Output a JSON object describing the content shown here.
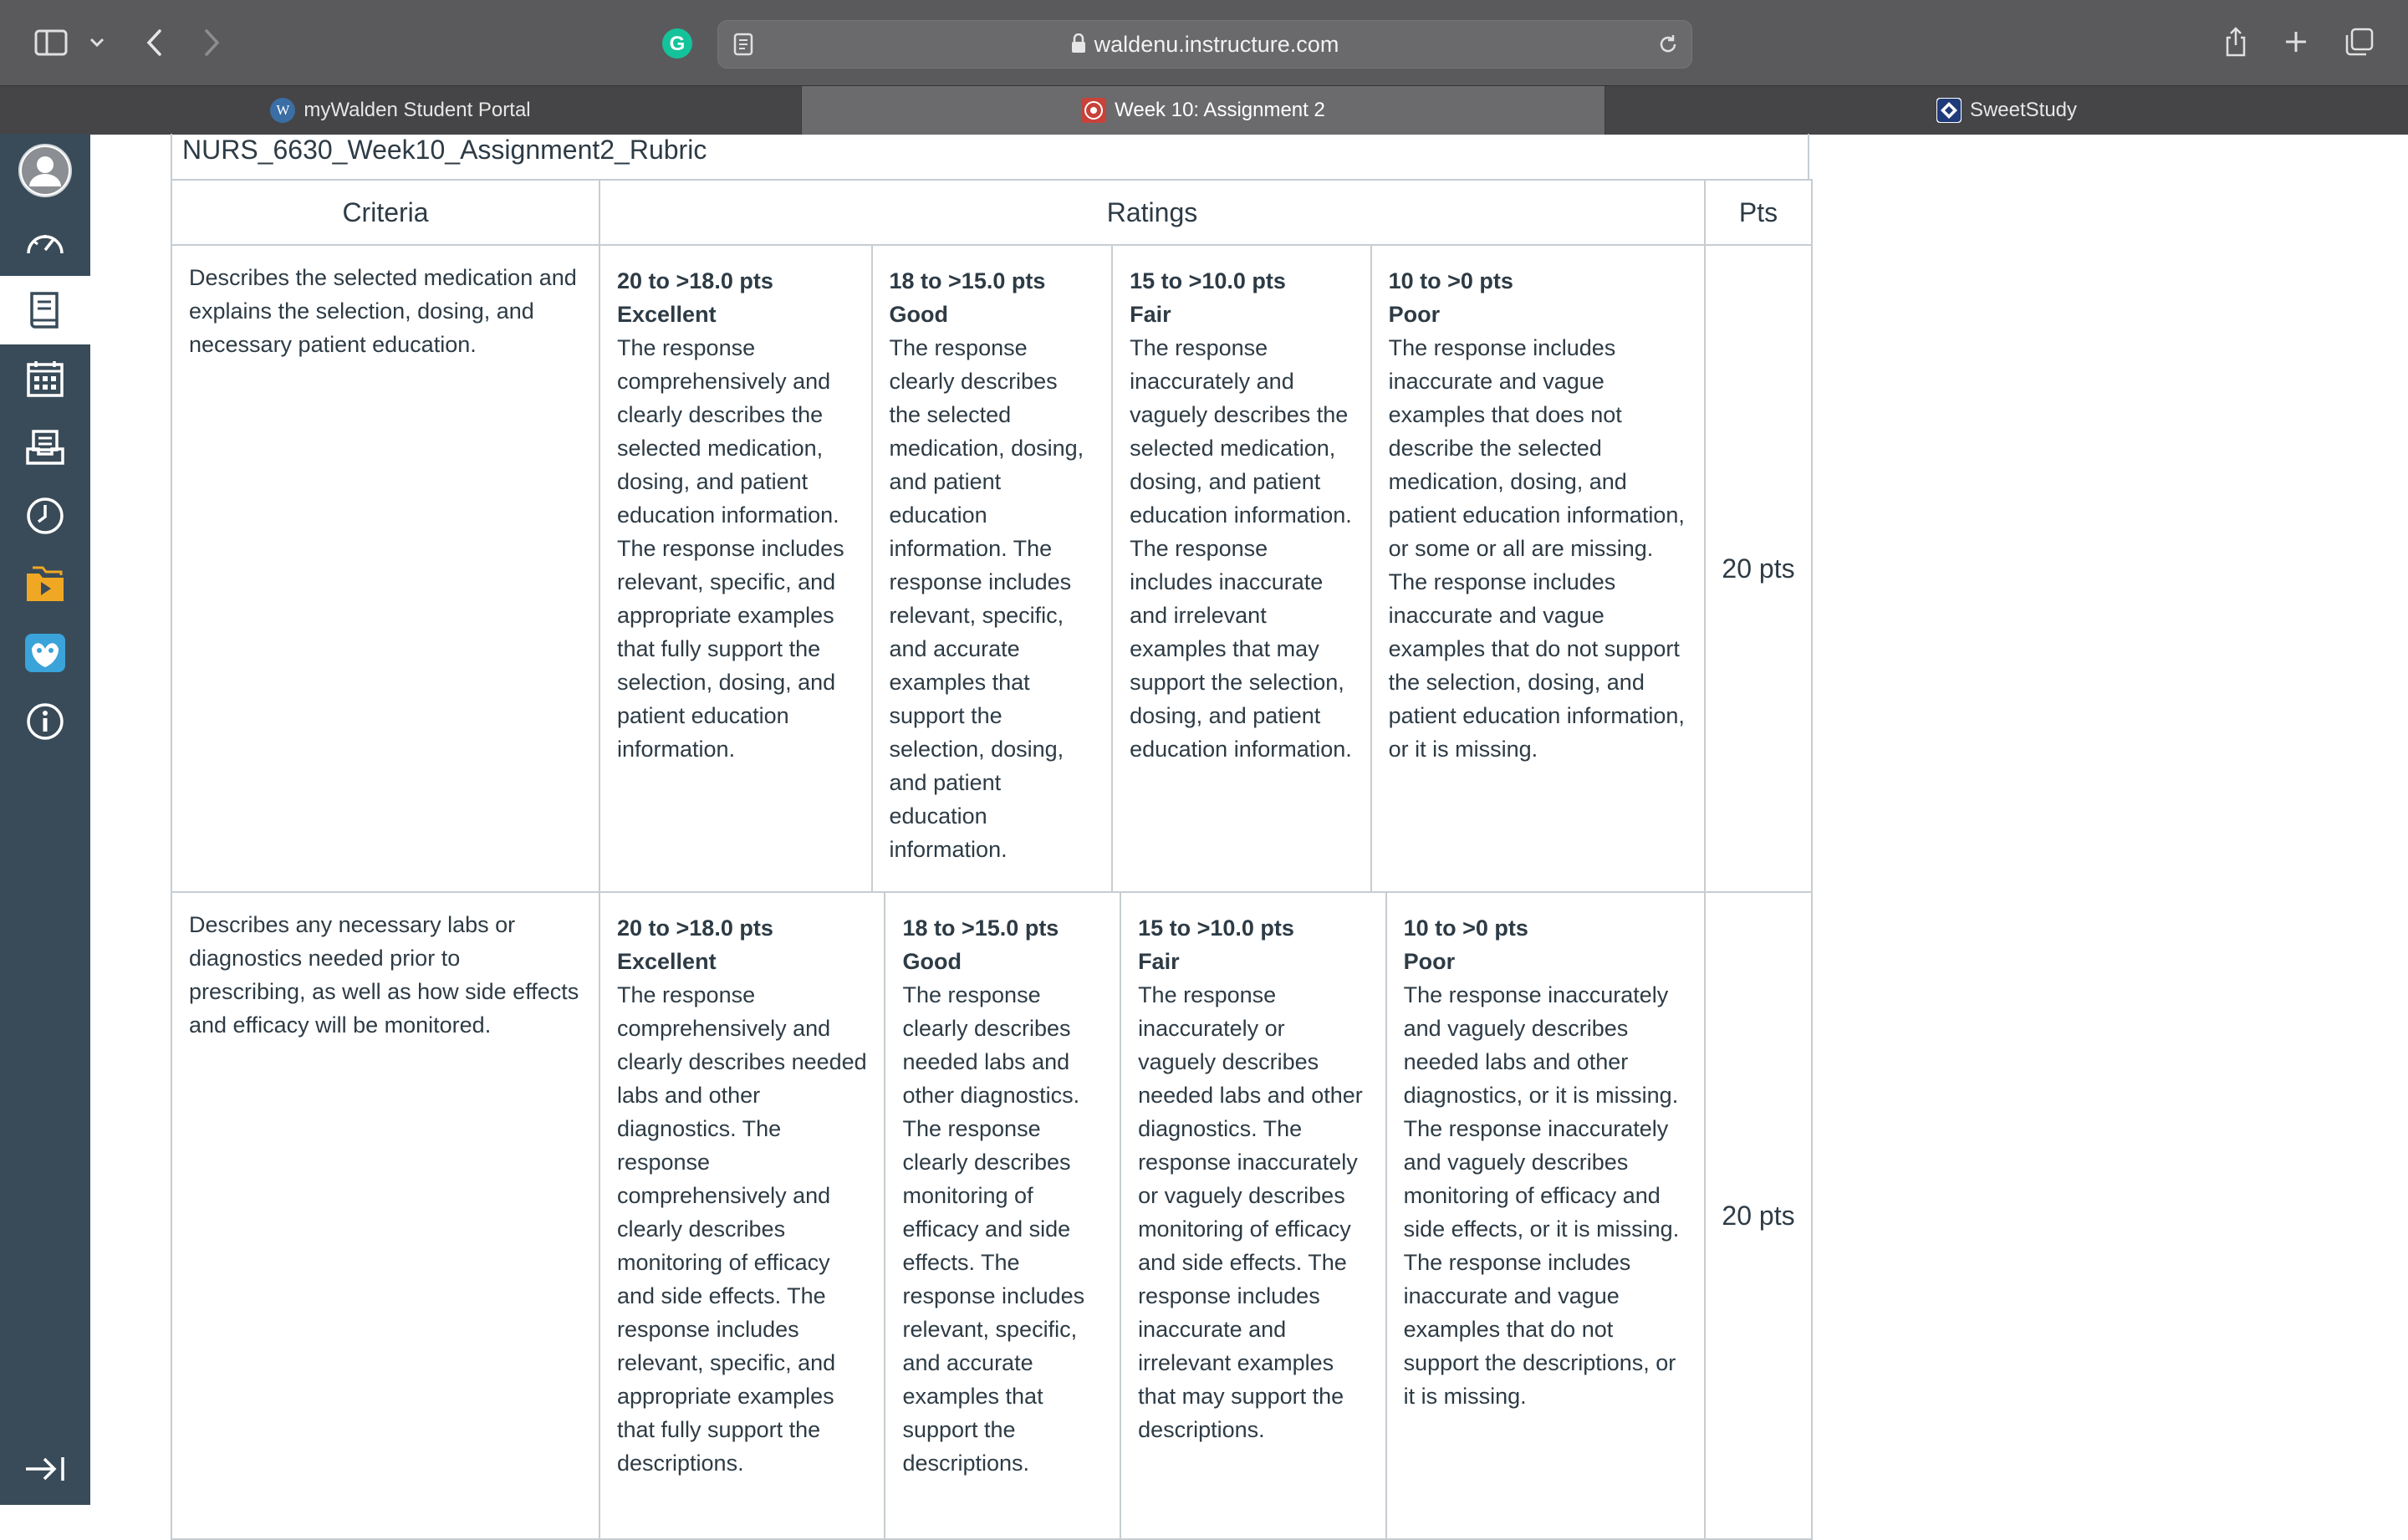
{
  "browser": {
    "url": "waldenu.instructure.com",
    "tabs": [
      {
        "label": "myWalden Student Portal",
        "favicon": "W"
      },
      {
        "label": "Week 10: Assignment 2",
        "favicon": ""
      },
      {
        "label": "SweetStudy",
        "favicon": ""
      }
    ]
  },
  "sidebar": {
    "items": [
      "account-icon",
      "dashboard-icon",
      "courses-icon",
      "calendar-icon",
      "inbox-icon",
      "history-icon",
      "files-icon",
      "help-icon",
      "info-icon"
    ],
    "collapse_icon": "collapse-nav-icon"
  },
  "rubric": {
    "title": "NURS_6630_Week10_Assignment2_Rubric",
    "headers": {
      "criteria": "Criteria",
      "ratings": "Ratings",
      "pts": "Pts"
    },
    "rows": [
      {
        "criteria": "Describes the selected medication and explains the selection, dosing, and necessary patient education.",
        "points": "20 pts",
        "ratings": [
          {
            "pts": "20 to >18.0 pts",
            "level": "Excellent",
            "desc": "The response comprehensively and clearly describes the selected medication, dosing, and patient education information. The response includes relevant, specific, and appropriate examples that fully support the selection, dosing, and patient education information."
          },
          {
            "pts": "18 to >15.0 pts",
            "level": "Good",
            "desc": "The response clearly describes the selected medication, dosing, and patient education information. The response includes relevant, specific, and accurate examples that support the selection, dosing, and patient education information."
          },
          {
            "pts": "15 to >10.0 pts",
            "level": "Fair",
            "desc": "The response inaccurately and vaguely describes the selected medication, dosing, and patient education information. The response includes inaccurate and irrelevant examples that may support the selection, dosing, and patient education information."
          },
          {
            "pts": "10 to >0 pts",
            "level": "Poor",
            "desc": "The response includes inaccurate and vague examples that does not describe the selected medication, dosing, and patient education information, or some or all are missing. The response includes inaccurate and vague examples that do not support the selection, dosing, and patient education information, or it is missing."
          }
        ]
      },
      {
        "criteria": "Describes any necessary labs or diagnostics needed prior to prescribing, as well as how side effects and efficacy will be monitored.",
        "points": "20 pts",
        "ratings": [
          {
            "pts": "20 to >18.0 pts",
            "level": "Excellent",
            "desc": "The response comprehensively and clearly describes needed labs and other diagnostics. The response comprehensively and clearly describes monitoring of efficacy and side effects. The response includes relevant, specific, and appropriate examples that fully support the descriptions."
          },
          {
            "pts": "18 to >15.0 pts",
            "level": "Good",
            "desc": "The response clearly describes needed labs and other diagnostics. The response clearly describes monitoring of efficacy and side effects. The response includes relevant, specific, and accurate examples that support the descriptions."
          },
          {
            "pts": "15 to >10.0 pts",
            "level": "Fair",
            "desc": "The response inaccurately or vaguely describes needed labs and other diagnostics. The response inaccurately or vaguely describes monitoring of efficacy and side effects. The response includes inaccurate and irrelevant examples that may support the descriptions."
          },
          {
            "pts": "10 to >0 pts",
            "level": "Poor",
            "desc": "The response inaccurately and vaguely describes needed labs and other diagnostics, or it is missing. The response inaccurately and vaguely describes monitoring of efficacy and side effects, or it is missing. The response includes inaccurate and vague examples that do not support the descriptions, or it is missing."
          }
        ]
      }
    ]
  }
}
